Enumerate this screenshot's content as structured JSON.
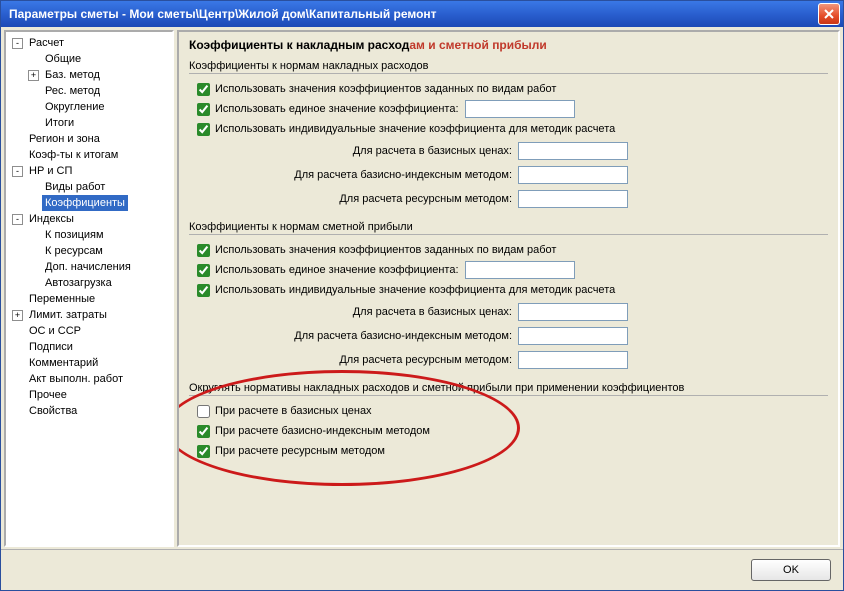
{
  "window": {
    "title": "Параметры сметы - Мои сметы\\Центр\\Жилой дом\\Капитальный ремонт"
  },
  "tree": {
    "items": [
      {
        "level": 1,
        "exp": "-",
        "label": "Расчет"
      },
      {
        "level": 2,
        "exp": "",
        "label": "Общие"
      },
      {
        "level": 2,
        "exp": "+",
        "label": "Баз. метод"
      },
      {
        "level": 2,
        "exp": "",
        "label": "Рес. метод"
      },
      {
        "level": 2,
        "exp": "",
        "label": "Округление"
      },
      {
        "level": 2,
        "exp": "",
        "label": "Итоги"
      },
      {
        "level": 1,
        "exp": "",
        "label": "Регион и зона"
      },
      {
        "level": 1,
        "exp": "",
        "label": "Коэф-ты к итогам"
      },
      {
        "level": 1,
        "exp": "-",
        "label": "НР и СП"
      },
      {
        "level": 2,
        "exp": "",
        "label": "Виды работ"
      },
      {
        "level": 2,
        "exp": "",
        "label": "Коэффициенты",
        "selected": true
      },
      {
        "level": 1,
        "exp": "-",
        "label": "Индексы"
      },
      {
        "level": 2,
        "exp": "",
        "label": "К позициям"
      },
      {
        "level": 2,
        "exp": "",
        "label": "К ресурсам"
      },
      {
        "level": 2,
        "exp": "",
        "label": "Доп. начисления"
      },
      {
        "level": 2,
        "exp": "",
        "label": "Автозагрузка"
      },
      {
        "level": 1,
        "exp": "",
        "label": "Переменные"
      },
      {
        "level": 1,
        "exp": "+",
        "label": "Лимит. затраты"
      },
      {
        "level": 1,
        "exp": "",
        "label": "ОС и ССР"
      },
      {
        "level": 1,
        "exp": "",
        "label": "Подписи"
      },
      {
        "level": 1,
        "exp": "",
        "label": "Комментарий"
      },
      {
        "level": 1,
        "exp": "",
        "label": "Акт выполн. работ"
      },
      {
        "level": 1,
        "exp": "",
        "label": "Прочее"
      },
      {
        "level": 1,
        "exp": "",
        "label": "Свойства"
      }
    ]
  },
  "content": {
    "title_part1": "Коэффициенты к накладным расход",
    "title_red": "ам и сметной прибыли",
    "group_nr": {
      "title": "Коэффициенты к нормам накладных расходов",
      "chk1": {
        "checked": true,
        "label": "Использовать значения коэффициентов заданных по видам работ"
      },
      "chk2": {
        "checked": true,
        "label": "Использовать единое значение коэффициента:",
        "value": ""
      },
      "chk3": {
        "checked": true,
        "label": "Использовать индивидуальные значение коэффициента для методик расчета"
      },
      "f1": {
        "label": "Для расчета в базисных ценах:",
        "value": ""
      },
      "f2": {
        "label": "Для расчета базисно-индексным методом:",
        "value": ""
      },
      "f3": {
        "label": "Для расчета ресурсным методом:",
        "value": ""
      }
    },
    "group_sp": {
      "title": "Коэффициенты к нормам сметной прибыли",
      "chk1": {
        "checked": true,
        "label": "Использовать значения коэффициентов заданных по видам работ"
      },
      "chk2": {
        "checked": true,
        "label": "Использовать единое значение коэффициента:",
        "value": ""
      },
      "chk3": {
        "checked": true,
        "label": "Использовать индивидуальные значение коэффициента для методик расчета"
      },
      "f1": {
        "label": "Для расчета в базисных ценах:",
        "value": ""
      },
      "f2": {
        "label": "Для расчета базисно-индексным методом:",
        "value": ""
      },
      "f3": {
        "label": "Для расчета ресурсным методом:",
        "value": ""
      }
    },
    "group_round": {
      "title": "Округлять нормативы накладных расходов и сметной прибыли при применении коэффициентов",
      "chk1": {
        "checked": false,
        "label": "При расчете в базисных ценах"
      },
      "chk2": {
        "checked": true,
        "label": "При расчете базисно-индексным методом"
      },
      "chk3": {
        "checked": true,
        "label": "При расчете ресурсным методом"
      }
    }
  },
  "buttons": {
    "ok": "OK"
  }
}
